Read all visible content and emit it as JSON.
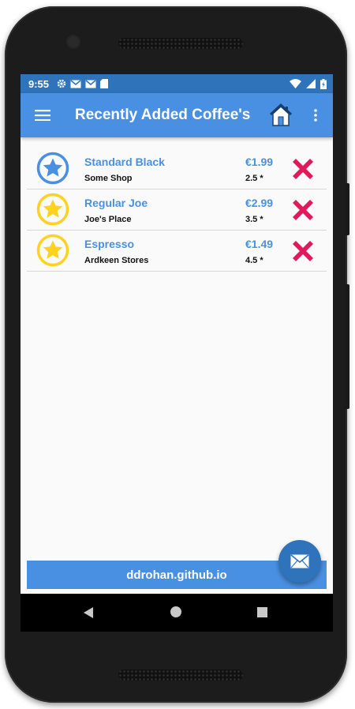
{
  "status_bar": {
    "time": "9:55",
    "icons": [
      "gear-icon",
      "gmail-icon",
      "gmail-icon",
      "sd-card-icon"
    ],
    "right_icons": [
      "wifi-icon",
      "signal-icon",
      "battery-charging-icon"
    ]
  },
  "app_bar": {
    "title": "Recently Added Coffee's"
  },
  "coffees": [
    {
      "name": "Standard Black",
      "shop": "Some Shop",
      "price": "€1.99",
      "rating": "2.5 *",
      "favourite": false
    },
    {
      "name": "Regular Joe",
      "shop": "Joe's Place",
      "price": "€2.99",
      "rating": "3.5 *",
      "favourite": true
    },
    {
      "name": "Espresso",
      "shop": "Ardkeen Stores",
      "price": "€1.49",
      "rating": "4.5 *",
      "favourite": true
    }
  ],
  "footer": {
    "text": "ddrohan.github.io"
  },
  "colors": {
    "primary": "#4a90e2",
    "status_bar": "#2f73ba",
    "favourite": "#ffd21f",
    "not_favourite": "#4a90e2",
    "delete": "#e0195a"
  }
}
